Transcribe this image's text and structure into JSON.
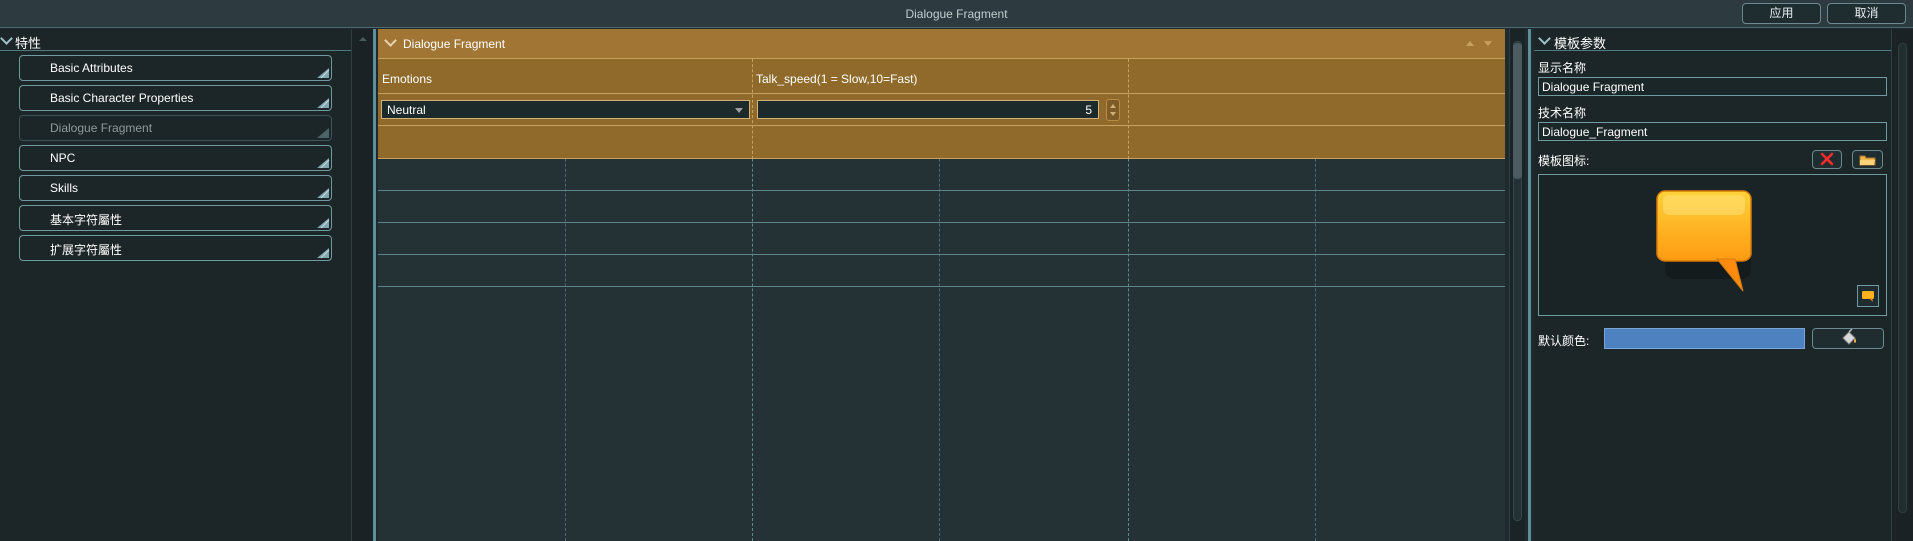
{
  "window": {
    "title": "Dialogue Fragment",
    "apply_label": "应用",
    "cancel_label": "取消"
  },
  "left_panel": {
    "header": "特性",
    "items": [
      {
        "label": "Basic Attributes",
        "enabled": true
      },
      {
        "label": "Basic Character Properties",
        "enabled": true
      },
      {
        "label": "Dialogue Fragment",
        "enabled": false
      },
      {
        "label": "NPC",
        "enabled": true
      },
      {
        "label": "Skills",
        "enabled": true
      },
      {
        "label": "基本字符屬性",
        "enabled": true
      },
      {
        "label": "扩展字符屬性",
        "enabled": true
      }
    ]
  },
  "center": {
    "section_title": "Dialogue Fragment",
    "emotions_label": "Emotions",
    "emotions_value": "Neutral",
    "talk_speed_label": "Talk_speed(1 = Slow,10=Fast)",
    "talk_speed_value": "5"
  },
  "right_panel": {
    "header": "模板参数",
    "display_name_label": "显示名称",
    "display_name_value": "Dialogue Fragment",
    "technical_name_label": "技术名称",
    "technical_name_value": "Dialogue_Fragment",
    "template_icon_label": "模板图标:",
    "template_icon": "speech-bubble-icon",
    "default_color_label": "默认颜色:",
    "default_color": "#4e81bf"
  },
  "colors": {
    "accent": "#a17635",
    "band": "#8f6a2a",
    "border": "#6f9aa0",
    "splitter": "#5e8f96"
  }
}
